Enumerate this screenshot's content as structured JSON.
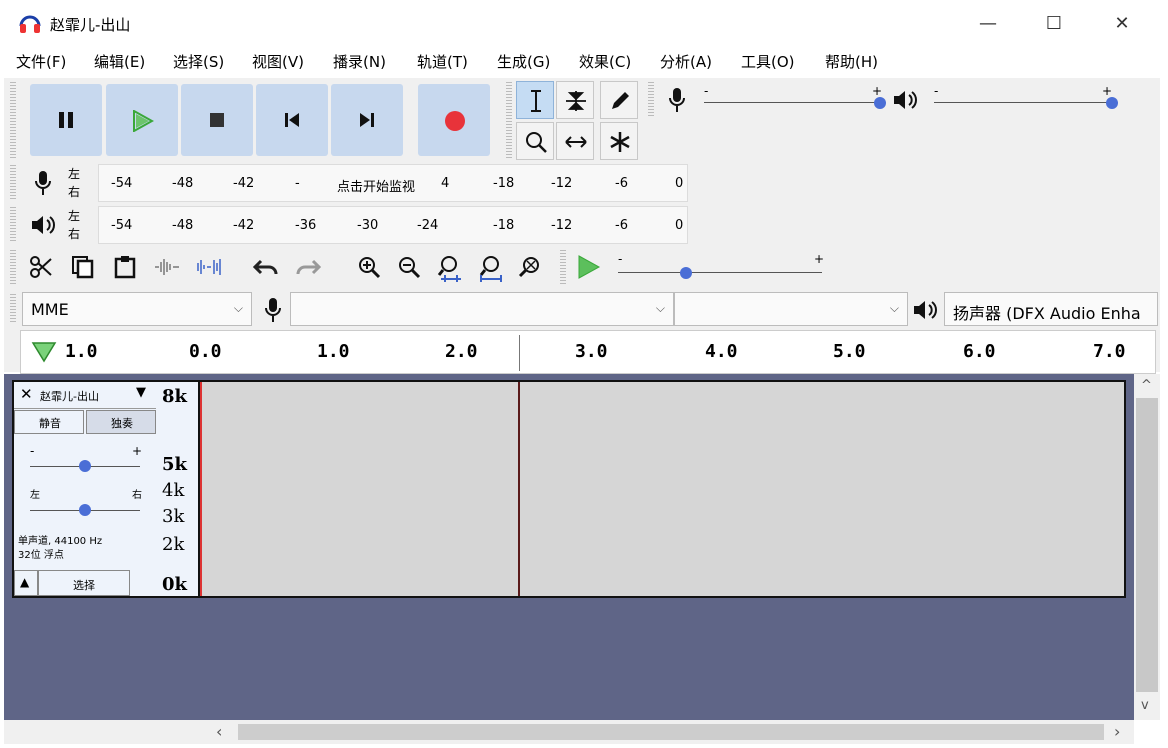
{
  "window": {
    "title": "赵霏儿-出山",
    "controls": [
      "—",
      "☐",
      "✕"
    ]
  },
  "menu": [
    "文件(F)",
    "编辑(E)",
    "选择(S)",
    "视图(V)",
    "播录(N)",
    "轨道(T)",
    "生成(G)",
    "效果(C)",
    "分析(A)",
    "工具(O)",
    "帮助(H)"
  ],
  "transport": [
    "pause-icon",
    "play-icon",
    "stop-icon",
    "skip-start-icon",
    "skip-end-icon",
    "record-icon"
  ],
  "meters": {
    "record_ticks": [
      "-54",
      "-48",
      "-42",
      "-",
      "-",
      "4",
      "-18",
      "-12",
      "-6",
      "0"
    ],
    "record_prompt": "点击开始监视",
    "play_ticks": [
      "-54",
      "-48",
      "-42",
      "-36",
      "-30",
      "-24",
      "-18",
      "-12",
      "-6",
      "0"
    ],
    "left": "左",
    "right": "右"
  },
  "mixer": {
    "minus": "-",
    "plus": "+"
  },
  "devices": {
    "host": "MME",
    "output": "扬声器 (DFX Audio Enha"
  },
  "ruler": [
    "1.0",
    "0.0",
    "1.0",
    "2.0",
    "3.0",
    "4.0",
    "5.0",
    "6.0",
    "7.0"
  ],
  "track": {
    "name": "赵霏儿-出山",
    "mute": "静音",
    "solo": "独奏",
    "pan_left": "左",
    "pan_right": "右",
    "gain_minus": "-",
    "gain_plus": "+",
    "info_line1": "单声道, 44100 Hz",
    "info_line2": "32位 浮点",
    "select": "选择",
    "freq_labels": [
      "8k",
      "5k",
      "4k",
      "3k",
      "2k",
      "0k"
    ]
  },
  "colors": {
    "accent": "#c7d8ee",
    "record": "#e8333a",
    "play": "#3aa83a",
    "track_bg": "#5f6587"
  }
}
